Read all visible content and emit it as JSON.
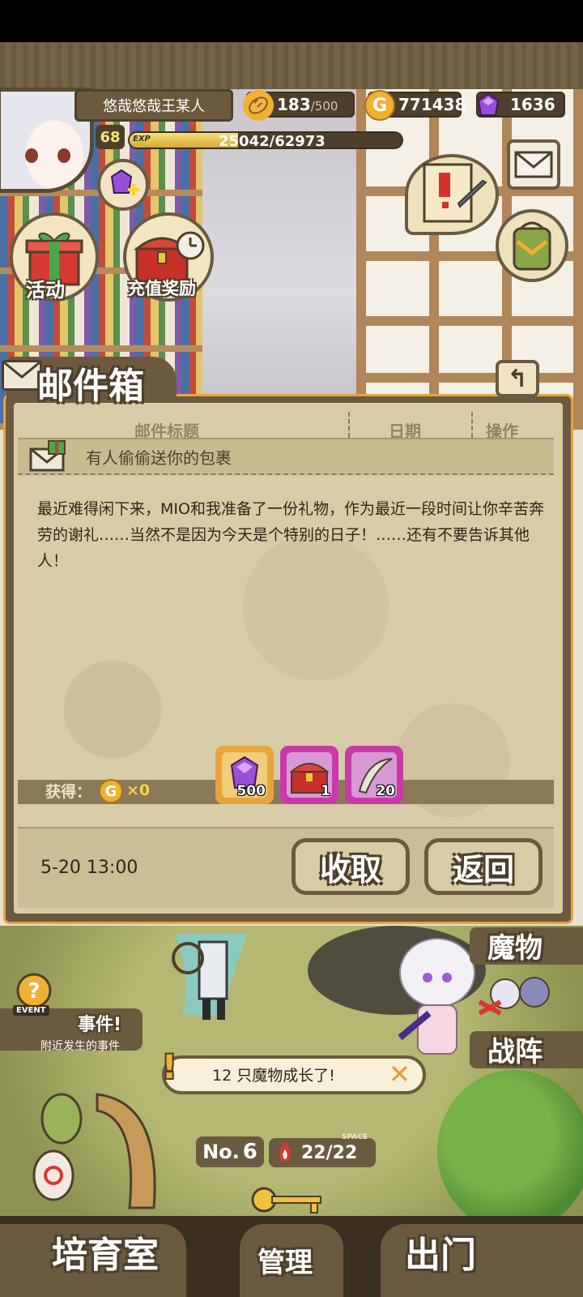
{
  "player": {
    "name": "悠哉悠哉王某人",
    "level": "68",
    "exp_label": "EXP",
    "exp_text": "25042/62973",
    "exp_fraction": 0.398
  },
  "resources": {
    "stamina": "183",
    "stamina_max": "/500",
    "gold": "771438",
    "gems": "1636"
  },
  "hud_buttons": {
    "events": "活动",
    "recharge": "充值奖励"
  },
  "mailbox": {
    "title": "邮件箱",
    "columns": [
      "邮件标题",
      "日期",
      "操作"
    ],
    "subject": "有人偷偷送你的包裹",
    "body": "最近难得闲下来，MIO和我准备了一份礼物，作为最近一段时间让你辛苦奔劳的谢礼……当然不是因为今天是个特别的日子！……还有不要告诉其他人！",
    "gain_label": "获得：",
    "gain_coin_symbol": "G",
    "gain_coin_count": "×0",
    "items": [
      {
        "icon": "purple-gem-icon",
        "count": "500",
        "frame": "#e8a43a",
        "bg": "#f1cc7a"
      },
      {
        "icon": "treasure-chest-icon",
        "count": "1",
        "frame": "#c83aa8",
        "bg": "#d89ad4"
      },
      {
        "icon": "claw-feather-icon",
        "count": "20",
        "frame": "#c83aa8",
        "bg": "#d89ad4"
      }
    ],
    "date": "5-20 13:00",
    "collect_label": "收取",
    "return_label": "返回"
  },
  "field": {
    "monsters_label": "魔物",
    "formation_label": "战阵",
    "event_tag": "EVENT",
    "event_title": "事件!",
    "event_sub": "附近发生的事件",
    "notice": "12 只魔物成长了!",
    "no_label": "No.",
    "no_value": "6",
    "space_label": "SPACE",
    "space_value": "22/22"
  },
  "bottom_nav": {
    "nursery": "培育室",
    "manage": "管理",
    "go_out": "出门"
  },
  "colors": {
    "frame_brown": "#6b5a3f",
    "panel_orange": "#e8a43a",
    "parchment": "#d8cca8",
    "gold_text": "#f6d34a"
  }
}
